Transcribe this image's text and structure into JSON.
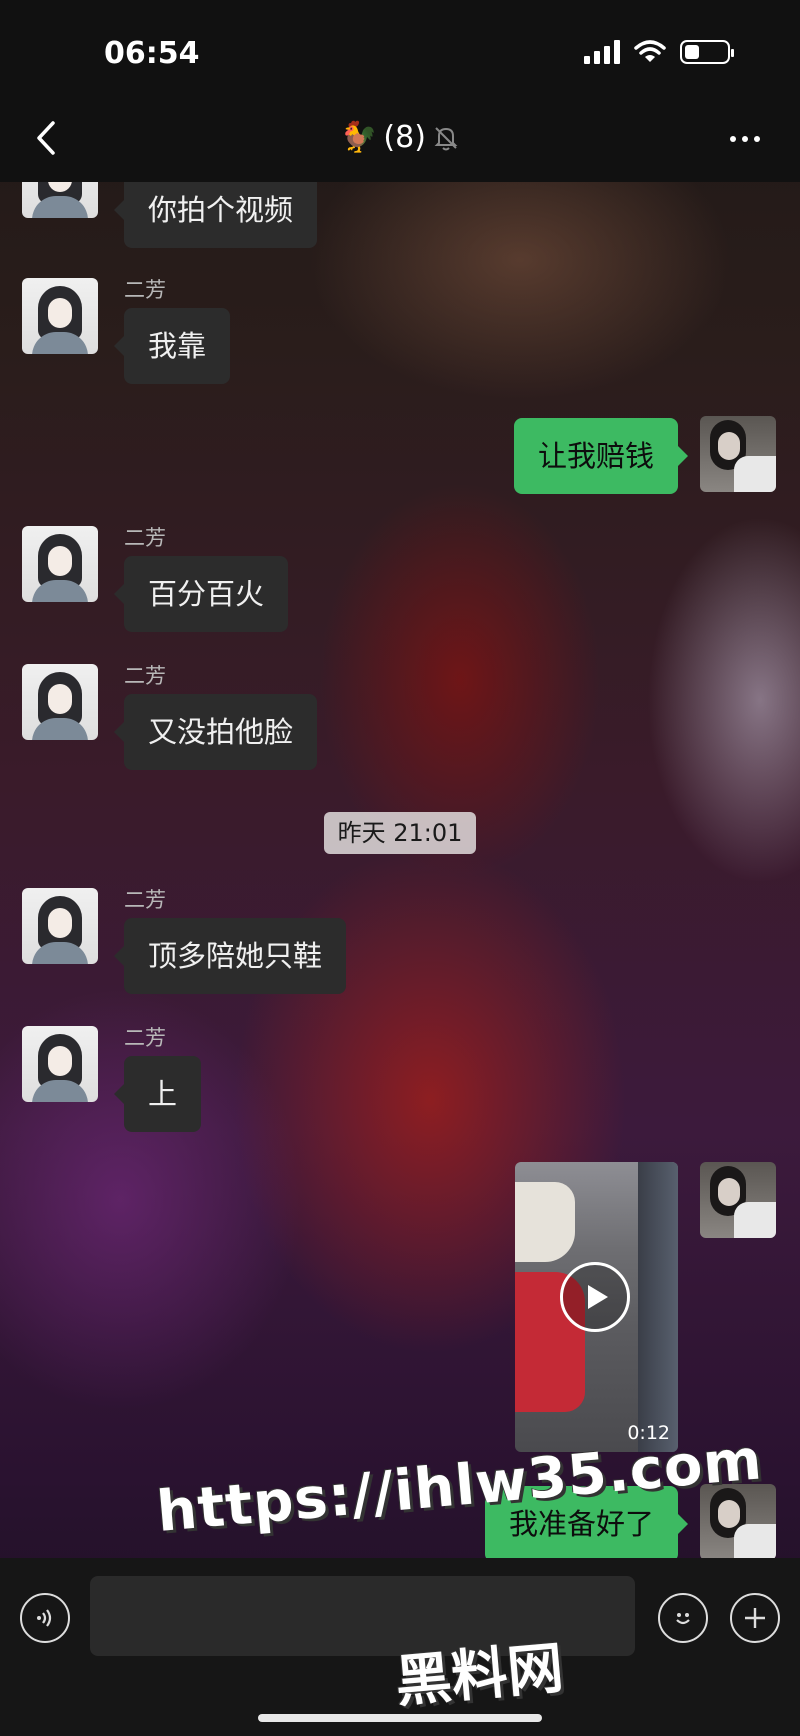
{
  "status_bar": {
    "time": "06:54"
  },
  "header": {
    "title_emoji": "🐓",
    "title_count": "(8)",
    "muted": true
  },
  "messages": [
    {
      "side": "in",
      "text": "你拍个视频"
    },
    {
      "side": "in",
      "sender": "二芳",
      "text": "我靠"
    },
    {
      "side": "out",
      "text": "让我赔钱"
    },
    {
      "side": "in",
      "sender": "二芳",
      "text": "百分百火"
    },
    {
      "side": "in",
      "sender": "二芳",
      "text": "又没拍他脸"
    },
    {
      "side": "in",
      "sender": "二芳",
      "text": "顶多陪她只鞋"
    },
    {
      "side": "in",
      "sender": "二芳",
      "text": "上"
    },
    {
      "side": "out",
      "type": "video",
      "duration": "0:12"
    },
    {
      "side": "out",
      "text": "我准备好了"
    }
  ],
  "timestamp": "昨天 21:01",
  "watermark": {
    "url": "https://ihlw35.com",
    "name": "黑料网"
  },
  "colors": {
    "outgoing_bubble": "#3dba62",
    "incoming_bubble": "#2c2c2c",
    "topbar": "#111111"
  }
}
